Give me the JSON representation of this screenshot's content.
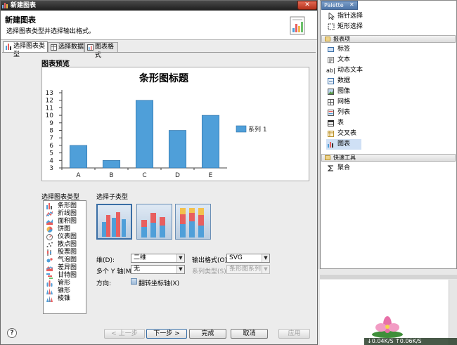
{
  "window": {
    "title": "新建图表",
    "close_label": "✕"
  },
  "banner": {
    "title": "新建图表",
    "description": "选择图表类型并选择输出格式。"
  },
  "tabs": [
    {
      "label": "选择图表类型",
      "active": true
    },
    {
      "label": "选择数据",
      "active": false
    },
    {
      "label": "图表格式",
      "active": false
    }
  ],
  "preview": {
    "heading": "图表预览"
  },
  "chart_data": {
    "type": "bar",
    "title": "条形图标题",
    "categories": [
      "A",
      "B",
      "C",
      "D",
      "E"
    ],
    "series": [
      {
        "name": "系列 1",
        "values": [
          6,
          4,
          12,
          8,
          10
        ],
        "color": "#4f9fd9"
      }
    ],
    "ylim": [
      3,
      13
    ],
    "yticks": [
      "3",
      "4",
      "5",
      "6",
      "7",
      "8",
      "9",
      "10",
      "11",
      "12",
      "13"
    ],
    "legend_position": "right",
    "grid": false
  },
  "chart_types": {
    "heading": "选择图表类型",
    "items": [
      "条形图",
      "折线图",
      "面积图",
      "饼图",
      "仪表图",
      "散点图",
      "股票图",
      "气泡图",
      "差异图",
      "甘特图",
      "管形",
      "锥形",
      "棱锥"
    ],
    "selected_index": 0
  },
  "subtypes": {
    "heading": "选择子类型",
    "selected_index": 0
  },
  "options": {
    "dimension_label": "维(D):",
    "dimension_value": "二维",
    "output_label": "输出格式(O):",
    "output_value": "SVG",
    "multi_y_label": "多个 Y 轴(M):",
    "multi_y_value": "无",
    "series_type_label": "系列类型(S):",
    "series_type_value": "条形图系列",
    "direction_label": "方向:",
    "flip_label": "翻转坐标轴(X)"
  },
  "buttons": {
    "back": "< 上一步",
    "next": "下一步 >",
    "finish": "完成",
    "cancel": "取消",
    "apply": "应用",
    "help": "?"
  },
  "palette": {
    "tab_label": "Palette",
    "close_label": "✕",
    "tools": [
      "指针选择",
      "矩形选择"
    ],
    "drawer_report": "报表项",
    "report_items": [
      "标签",
      "文本",
      "动态文本",
      "数据",
      "图像",
      "网格",
      "列表",
      "表",
      "交叉表",
      "图表"
    ],
    "selected_item": "图表",
    "drawer_quick": "快速工具",
    "quick_items": [
      "聚合"
    ]
  },
  "status": {
    "net_speed": "↓0.04K/S ↑0.06K/S"
  }
}
